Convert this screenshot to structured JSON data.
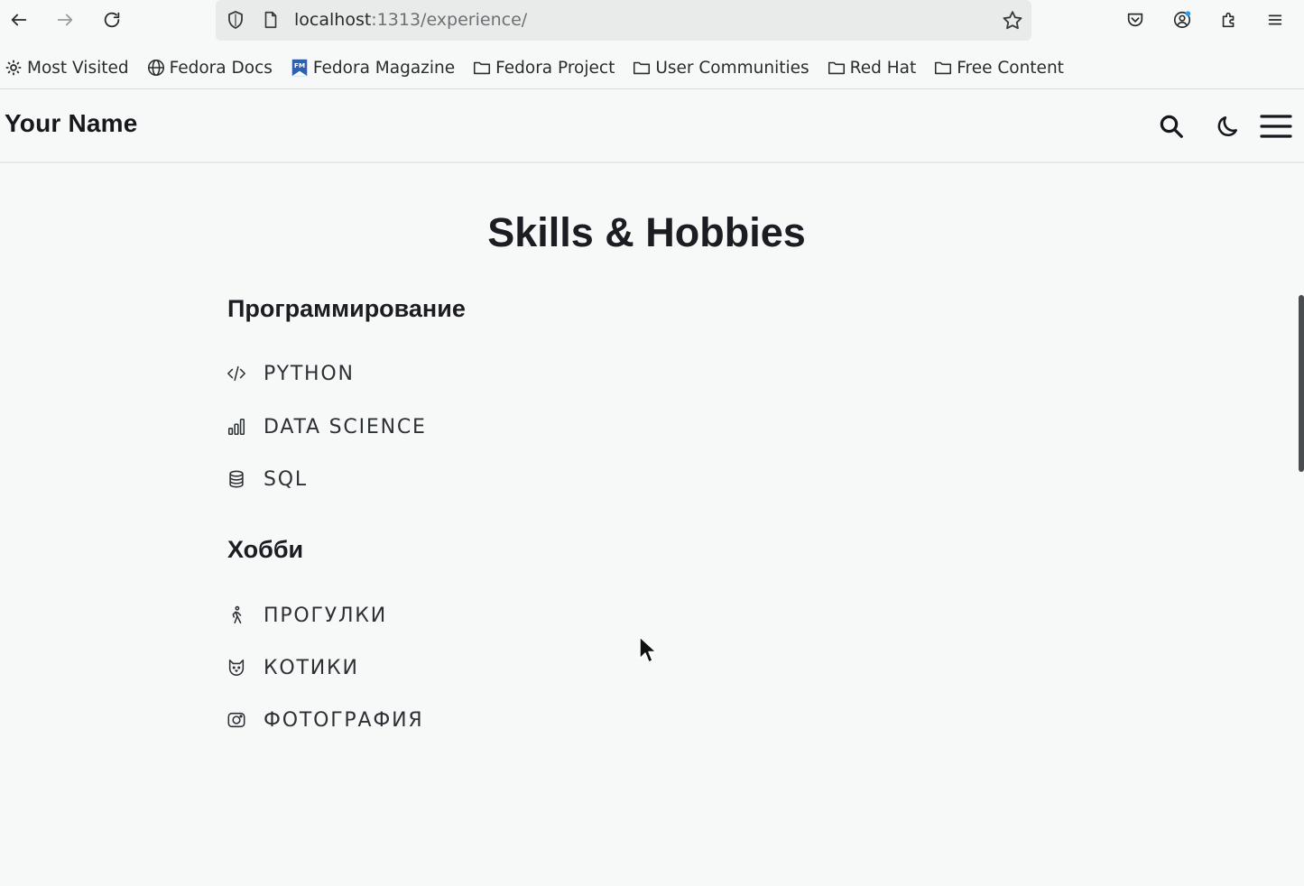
{
  "browser": {
    "url_host": "localhost",
    "url_path": ":1313/experience/",
    "bookmarks": [
      {
        "label": "Most Visited",
        "icon": "gear-icon"
      },
      {
        "label": "Fedora Docs",
        "icon": "globe-icon"
      },
      {
        "label": "Fedora Magazine",
        "icon": "fedora-magazine-icon"
      },
      {
        "label": "Fedora Project",
        "icon": "folder-icon"
      },
      {
        "label": "User Communities",
        "icon": "folder-icon"
      },
      {
        "label": "Red Hat",
        "icon": "folder-icon"
      },
      {
        "label": "Free Content",
        "icon": "folder-icon"
      }
    ]
  },
  "site": {
    "logo": "Your Name"
  },
  "main": {
    "title": "Skills & Hobbies",
    "sections": [
      {
        "title": "Программирование",
        "items": [
          {
            "label": "Python",
            "icon": "code-icon"
          },
          {
            "label": "Data Science",
            "icon": "bar-chart-icon"
          },
          {
            "label": "SQL",
            "icon": "database-icon"
          }
        ]
      },
      {
        "title": "Хобби",
        "items": [
          {
            "label": "Прогулки",
            "icon": "walking-icon"
          },
          {
            "label": "Котики",
            "icon": "cat-icon"
          },
          {
            "label": "Фотография",
            "icon": "camera-icon"
          }
        ]
      }
    ]
  },
  "colors": {
    "background": "#f7f9f8",
    "text": "#1a1d21",
    "url_bar": "#e9ebea",
    "notification_dot": "#2a9af2"
  }
}
